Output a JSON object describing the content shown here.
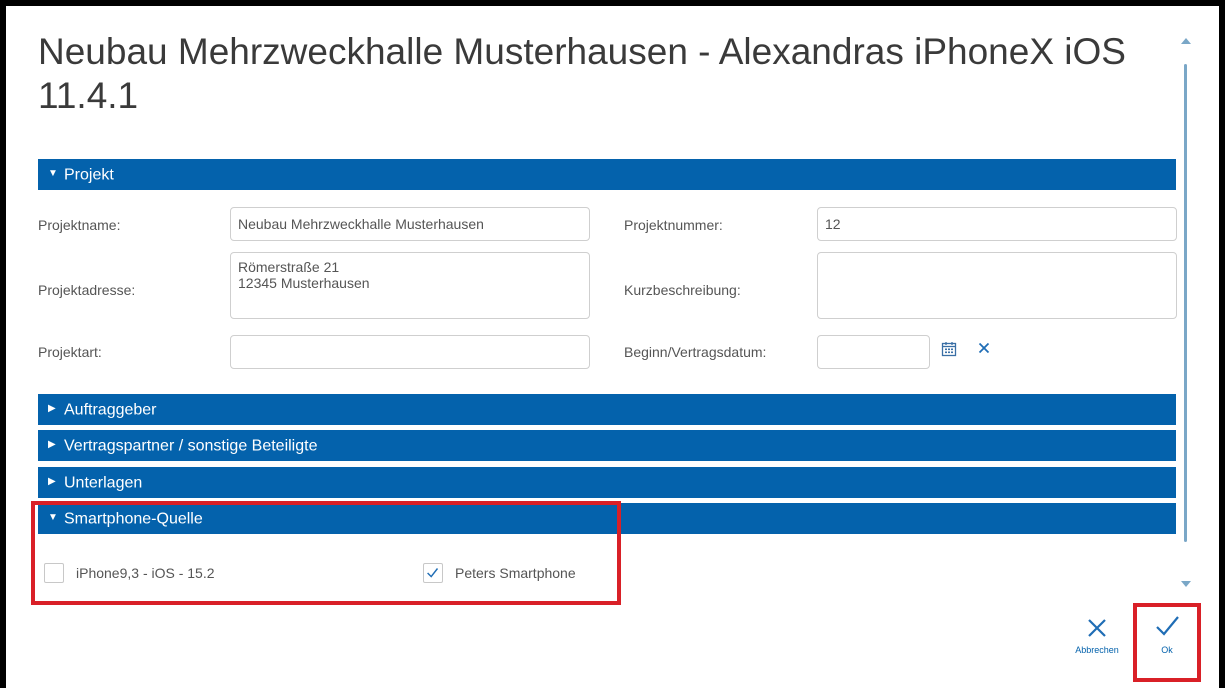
{
  "dialog": {
    "title": "Neubau Mehrzweckhalle Musterhausen - Alexandras iPhoneX iOS 11.4.1"
  },
  "sections": {
    "projekt": "Projekt",
    "auftraggeber": "Auftraggeber",
    "vertragspartner": "Vertragspartner / sonstige Beteiligte",
    "unterlagen": "Unterlagen",
    "smartphone": "Smartphone-Quelle"
  },
  "projekt": {
    "projektname_label": "Projektname:",
    "projektname_value": "Neubau Mehrzweckhalle Musterhausen",
    "projektnummer_label": "Projektnummer:",
    "projektnummer_value": "12",
    "projektadresse_label": "Projektadresse:",
    "projektadresse_value": "Römerstraße 21\n12345 Musterhausen",
    "kurzbeschreibung_label": "Kurzbeschreibung:",
    "kurzbeschreibung_value": "",
    "projektart_label": "Projektart:",
    "projektart_value": "",
    "beginn_label": "Beginn/Vertragsdatum:",
    "beginn_value": ""
  },
  "smartphone_sources": [
    {
      "label": "iPhone9,3 - iOS - 15.2",
      "checked": false
    },
    {
      "label": "Peters Smartphone",
      "checked": true
    }
  ],
  "actions": {
    "cancel_label": "Abbrechen",
    "ok_label": "Ok"
  },
  "colors": {
    "accent": "#0462ac",
    "highlight": "#d92027"
  }
}
